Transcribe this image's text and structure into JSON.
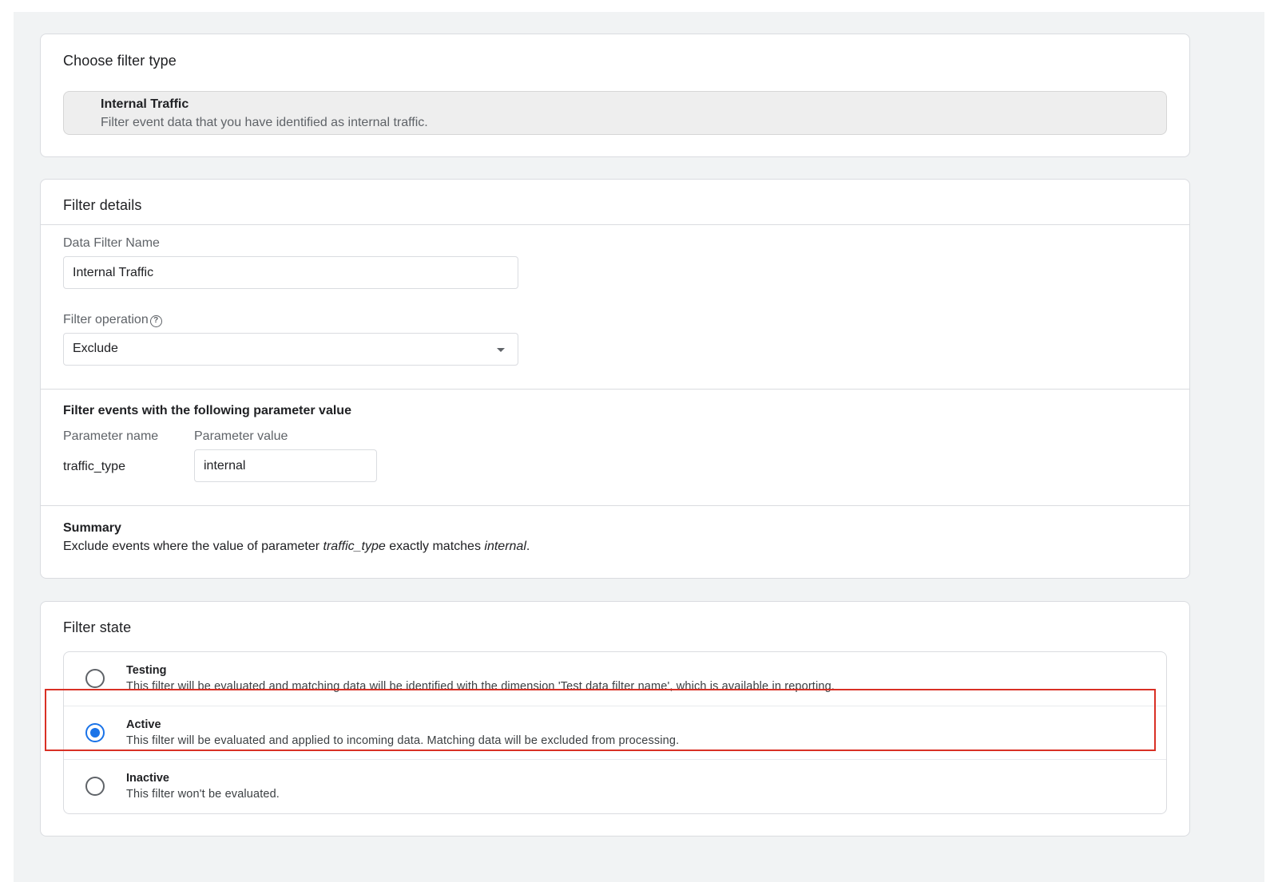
{
  "filter_type": {
    "heading": "Choose filter type",
    "selected": {
      "title": "Internal Traffic",
      "description": "Filter event data that you have identified as internal traffic."
    }
  },
  "filter_details": {
    "heading": "Filter details",
    "name_label": "Data Filter Name",
    "name_value": "Internal Traffic",
    "operation_label": "Filter operation",
    "operation_value": "Exclude",
    "parameter_heading": "Filter events with the following parameter value",
    "param_name_label": "Parameter name",
    "param_value_label": "Parameter value",
    "param_name": "traffic_type",
    "param_value": "internal",
    "summary_heading": "Summary",
    "summary": {
      "prefix": "Exclude events where the value of parameter ",
      "param": "traffic_type",
      "middle": " exactly matches ",
      "value": "internal",
      "suffix": "."
    }
  },
  "filter_state": {
    "heading": "Filter state",
    "selected": "Active",
    "options": [
      {
        "title": "Testing",
        "description": "This filter will be evaluated and matching data will be identified with the dimension 'Test data filter name', which is available in reporting."
      },
      {
        "title": "Active",
        "description": "This filter will be evaluated and applied to incoming data. Matching data will be excluded from processing."
      },
      {
        "title": "Inactive",
        "description": "This filter won't be evaluated."
      }
    ]
  },
  "colors": {
    "accent": "#1a73e8",
    "highlight": "#d93025",
    "background": "#f1f3f4"
  },
  "icons": {
    "help": "help-circle-icon",
    "dropdown": "chevron-down-icon"
  }
}
